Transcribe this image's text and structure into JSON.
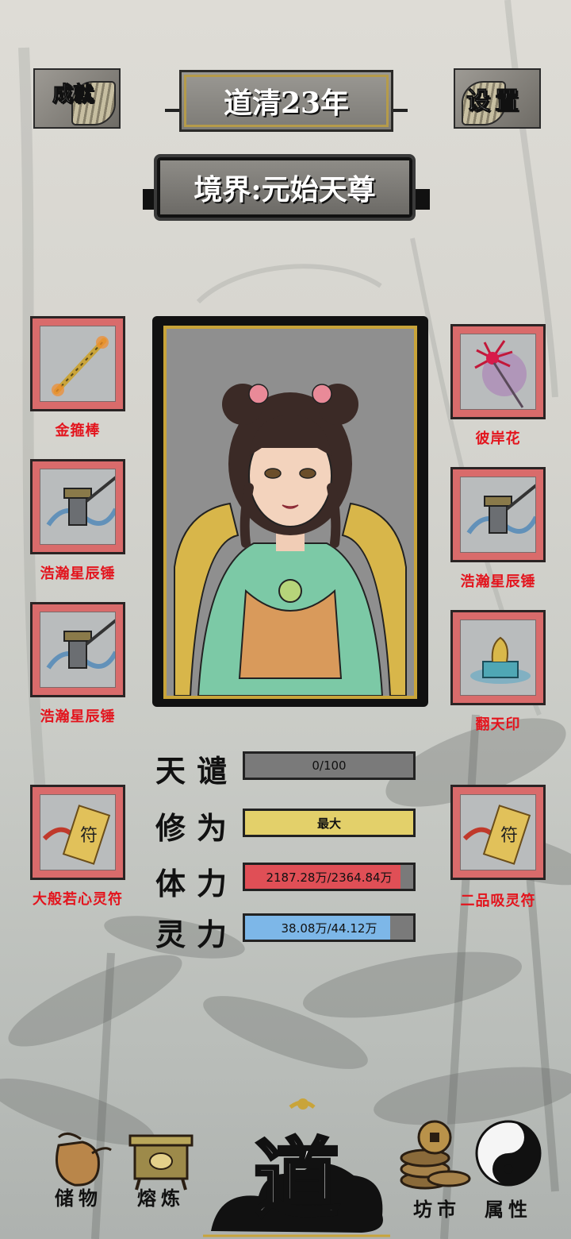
{
  "header": {
    "achievements_label": "成就",
    "year_title": "道清23年",
    "settings_label": "设置",
    "realm": "境界:元始天尊"
  },
  "left_items": [
    {
      "name": "金箍棒"
    },
    {
      "name": "浩瀚星辰锤"
    },
    {
      "name": "浩瀚星辰锤"
    },
    {
      "name": "大般若心灵符"
    }
  ],
  "right_items": [
    {
      "name": "彼岸花"
    },
    {
      "name": "浩瀚星辰锤"
    },
    {
      "name": "翻天印"
    },
    {
      "name": "二品吸灵符"
    }
  ],
  "stats": {
    "tribulation": {
      "label": "天谴",
      "text": "0/100",
      "fraction": 0.0
    },
    "cultivation": {
      "label": "修为",
      "text": "最大",
      "fraction": 1.0
    },
    "stamina": {
      "label": "体力",
      "text": "2187.28万/2364.84万",
      "fraction": 0.925
    },
    "spirit": {
      "label": "灵力",
      "text": "38.08万/44.12万",
      "fraction": 0.863
    }
  },
  "nav": {
    "storage": "储物",
    "smelt": "熔炼",
    "center": "道",
    "market": "坊市",
    "attributes": "属性"
  },
  "colors": {
    "slot_border": "#d96b6b",
    "item_label": "#e3141d",
    "bar_cultivation": "#e3d06a",
    "bar_stamina": "#e04f56",
    "bar_spirit": "#7db7e8",
    "frame_gold": "#c9a43a"
  }
}
